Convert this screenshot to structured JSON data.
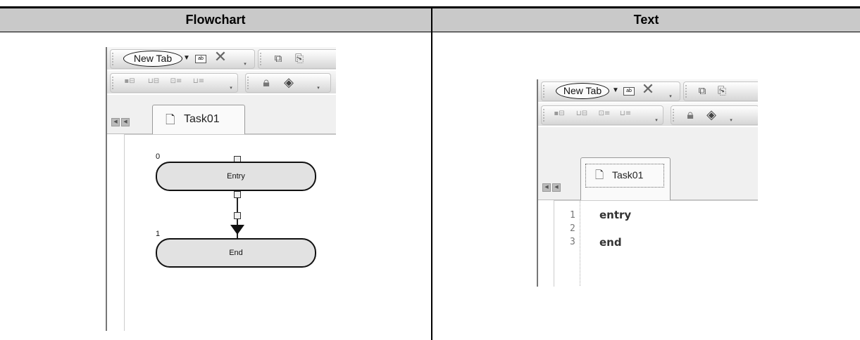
{
  "header": {
    "left_title": "Flowchart",
    "right_title": "Text"
  },
  "flowchart_view": {
    "toolbar": {
      "new_tab_label": "New Tab",
      "icons": [
        "dropdown-arrow-icon",
        "rename-tab-icon",
        "close-tab-icon",
        "copy-icon",
        "export-icon",
        "insert-step-icon",
        "insert-branch-icon",
        "insert-loop-icon",
        "insert-end-icon",
        "lock-icon",
        "compile-icon"
      ]
    },
    "tab_label": "Task01",
    "nodes": [
      {
        "number": "0",
        "label": "Entry"
      },
      {
        "number": "1",
        "label": "End"
      }
    ]
  },
  "text_view": {
    "toolbar": {
      "new_tab_label": "New Tab"
    },
    "tab_label": "Task01",
    "lines": [
      {
        "number": "1",
        "code": "entry"
      },
      {
        "number": "2",
        "code": ""
      },
      {
        "number": "3",
        "code": "end"
      }
    ]
  },
  "colors": {
    "header_bg": "#c9c9c9",
    "node_fill": "#e2e2e2",
    "border": "#000000"
  }
}
